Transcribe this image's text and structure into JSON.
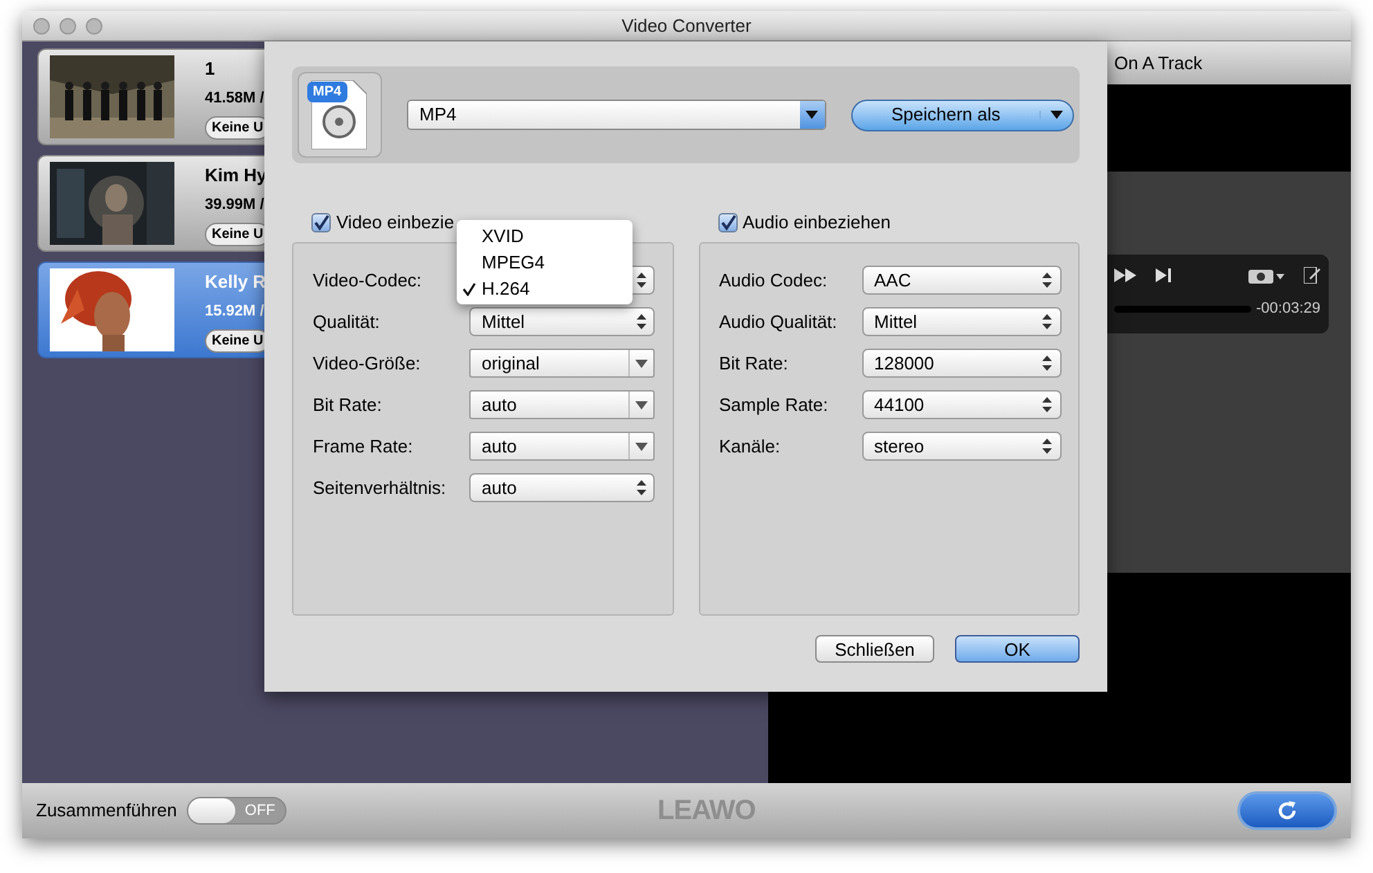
{
  "window": {
    "title": "Video Converter"
  },
  "files": [
    {
      "title": "1",
      "size": "41.58M /",
      "subtitle": "Keine U",
      "selected": false
    },
    {
      "title": "Kim Hy",
      "size": "39.99M /",
      "subtitle": "Keine U",
      "selected": false
    },
    {
      "title": "Kelly R",
      "size": "15.92M /",
      "subtitle": "Keine U",
      "selected": true
    }
  ],
  "player": {
    "title": "On A Track",
    "time": "-00:03:29"
  },
  "dialog": {
    "format_badge": "MP4",
    "format": "MP4",
    "save_button": "Speichern als",
    "video": {
      "label": "Video einbezie",
      "checked": true,
      "fields": [
        {
          "label": "Video-Codec:",
          "kind": "stepper"
        },
        {
          "label": "Qualität:",
          "value": "Mittel",
          "kind": "stepper"
        },
        {
          "label": "Video-Größe:",
          "value": "original",
          "kind": "combo"
        },
        {
          "label": "Bit Rate:",
          "value": "auto",
          "kind": "combo"
        },
        {
          "label": "Frame Rate:",
          "value": "auto",
          "kind": "combo"
        },
        {
          "label": "Seitenverhältnis:",
          "value": "auto",
          "kind": "stepper"
        }
      ]
    },
    "audio": {
      "label": "Audio einbeziehen",
      "checked": true,
      "fields": [
        {
          "label": "Audio Codec:",
          "value": "AAC",
          "kind": "stepper"
        },
        {
          "label": "Audio Qualität:",
          "value": "Mittel",
          "kind": "stepper"
        },
        {
          "label": "Bit Rate:",
          "value": "128000",
          "kind": "stepper"
        },
        {
          "label": "Sample Rate:",
          "value": "44100",
          "kind": "stepper"
        },
        {
          "label": "Kanäle:",
          "value": "stereo",
          "kind": "stepper"
        }
      ]
    },
    "codec_menu": [
      {
        "label": "XVID",
        "selected": false
      },
      {
        "label": "MPEG4",
        "selected": false
      },
      {
        "label": "H.264",
        "selected": true
      }
    ],
    "buttons": [
      {
        "label": "Schließen",
        "kind": "normal"
      },
      {
        "label": "OK",
        "kind": "default"
      }
    ]
  },
  "bottom": {
    "merge_label": "Zusammenführen",
    "merge_toggle": {
      "on": false,
      "text": "OFF"
    },
    "logo": "LEAWO"
  }
}
